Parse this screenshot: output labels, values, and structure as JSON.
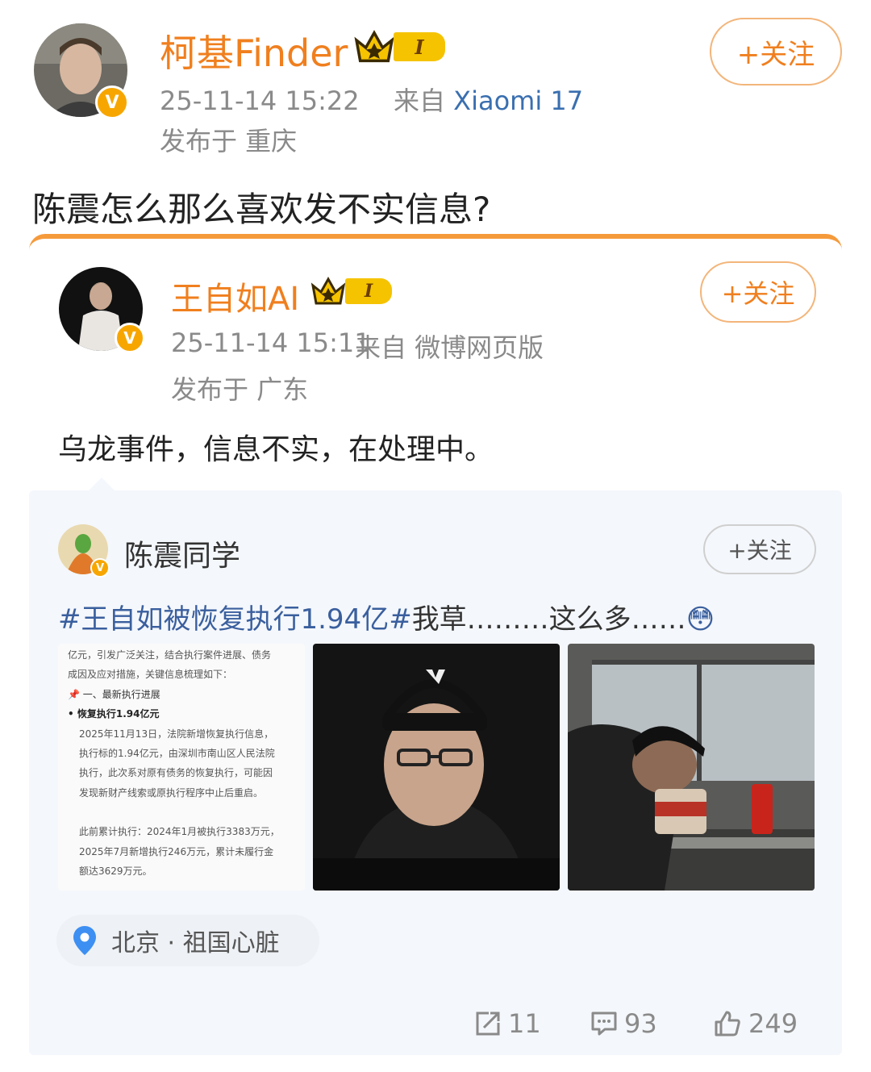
{
  "post": {
    "author": "柯基Finder",
    "vip_level": "I",
    "time": "25-11-14 15:22",
    "source_prefix": "来自",
    "source_device": "Xiaomi 17",
    "location": "发布于 重庆",
    "follow_label": "+关注",
    "text": "陈震怎么那么喜欢发不实信息?"
  },
  "repost": {
    "author": "王自如AI",
    "vip_level": "I",
    "time": "25-11-14 15:11",
    "source": "来自 微博网页版",
    "location": "发布于 广东",
    "follow_label": "+关注",
    "text": "乌龙事件，信息不实，在处理中。"
  },
  "quoted": {
    "author": "陈震同学",
    "follow_label": "+关注",
    "topic1": "#王自如被恢复执行1.94亿#",
    "body": "我草………这么多……",
    "emoji": "😳",
    "doc_lines": [
      "亿元，引发广泛关注，结合执行案件进展、债务",
      "成因及应对措施，关键信息梳理如下：",
      "📌 一、最新执行进展",
      "• 恢复执行1.94亿元",
      "2025年11月13日，法院新增恢复执行信息，",
      "执行标的1.94亿元，由深圳市南山区人民法院",
      "执行，此次系对原有债务的恢复执行，可能因",
      "发现新财产线索或原执行程序中止后重启。",
      "此前累计执行：2024年1月被执行3383万元，",
      "2025年7月新增执行246万元，累计未履行金",
      "额达3629万元。"
    ],
    "location": "北京 · 祖国心脏"
  },
  "actions": {
    "repost_count": "11",
    "comment_count": "93",
    "like_count": "249"
  },
  "colors": {
    "name_orange": "#f07f1e",
    "link_blue": "#3a5f9e",
    "badge_gold": "#f7a600"
  }
}
